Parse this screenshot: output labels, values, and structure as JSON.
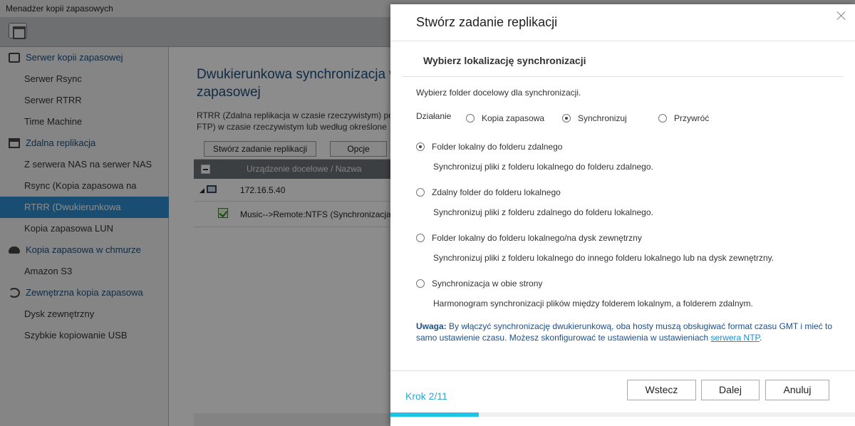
{
  "app": {
    "window_title": "Menadżer kopii zapasowych"
  },
  "sidebar": {
    "items": [
      {
        "label": "Serwer kopii zapasowej",
        "type": "group",
        "icon": "hdd-icon"
      },
      {
        "label": "Serwer Rsync",
        "type": "item"
      },
      {
        "label": "Serwer RTRR",
        "type": "item"
      },
      {
        "label": "Time Machine",
        "type": "item"
      },
      {
        "label": "Zdalna replikacja",
        "type": "group",
        "icon": "replication-icon"
      },
      {
        "label": "Z serwera NAS na serwer NAS",
        "type": "item"
      },
      {
        "label": "Rsync (Kopia zapasowa na pozio…",
        "type": "item"
      },
      {
        "label": "RTRR (Dwukierunkowa synchroni…",
        "type": "item",
        "active": true
      },
      {
        "label": "Kopia zapasowa LUN",
        "type": "item"
      },
      {
        "label": "Kopia zapasowa w chmurze",
        "type": "group",
        "icon": "cloud-icon"
      },
      {
        "label": "Amazon S3",
        "type": "item"
      },
      {
        "label": "Zewnętrzna kopia zapasowa",
        "type": "group",
        "icon": "sync-icon"
      },
      {
        "label": "Dysk zewnętrzny",
        "type": "item"
      },
      {
        "label": "Szybkie kopiowanie USB",
        "type": "item"
      }
    ]
  },
  "main": {
    "title": "Dwukierunkowa synchronizacja w zapasowej",
    "description": "RTRR (Zdalna replikacja w czasie rzeczywistym) po FTP) w czasie rzeczywistym lub według określone",
    "create_button": "Stwórz zadanie replikacji",
    "options_button": "Opcje",
    "grid_header": "Urządzenie docelowe / Nazwa zadania",
    "rows": [
      {
        "label": "172.16.5.40",
        "kind": "device"
      },
      {
        "label": "Music-->Remote:NTFS (Synchronizacja w c",
        "kind": "job"
      }
    ]
  },
  "dialog": {
    "title": "Stwórz zadanie replikacji",
    "section_title": "Wybierz lokalizację synchronizacji",
    "intro": "Wybierz folder docelowy dla synchronizacji.",
    "action_label": "Działanie",
    "actions": [
      {
        "label": "Kopia zapasowa",
        "selected": false
      },
      {
        "label": "Synchronizuj",
        "selected": true
      },
      {
        "label": "Przywróć",
        "selected": false
      }
    ],
    "options": [
      {
        "label": "Folder lokalny do folderu zdalnego",
        "desc": "Synchronizuj pliki z folderu lokalnego do folderu zdalnego.",
        "selected": true
      },
      {
        "label": "Zdalny folder do folderu lokalnego",
        "desc": "Synchronizuj pliki z folderu zdalnego do folderu lokalnego.",
        "selected": false
      },
      {
        "label": "Folder lokalny do folderu lokalnego/na dysk zewnętrzny",
        "desc": "Synchronizuj pliki z folderu lokalnego do innego folderu lokalnego lub na dysk zewnętrzny.",
        "selected": false
      },
      {
        "label": "Synchronizacja w obie strony",
        "desc": "Harmonogram synchronizacji plików między folderem lokalnym, a folderem zdalnym.",
        "selected": false
      }
    ],
    "note_prefix": "Uwaga:",
    "note_text": "By włączyć synchronizację dwukierunkową, oba hosty muszą obsługiwać format czasu GMT i mieć to samo ustawienie czasu. Możesz skonfigurować te ustawienia w ustawieniach",
    "note_link": "serwera NTP",
    "note_end": ".",
    "step": "Krok 2/11",
    "back_button": "Wstecz",
    "next_button": "Dalej",
    "cancel_button": "Anuluj",
    "progress_fraction": 0.1905,
    "accent_color": "#1ec4e8"
  }
}
